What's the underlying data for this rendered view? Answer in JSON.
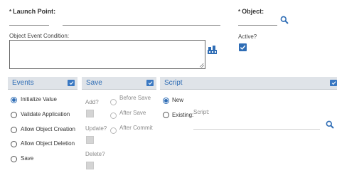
{
  "header": {
    "launch_point_label": "Launch Point:",
    "launch_point_value": "",
    "launch_point_description": "",
    "object_label": "Object:",
    "object_value": "",
    "event_condition_label": "Object Event Condition:",
    "event_condition_value": "",
    "active_label": "Active?",
    "active_checked": true
  },
  "events": {
    "title": "Events",
    "options": [
      {
        "label": "Initialize Value",
        "selected": true
      },
      {
        "label": "Validate Application",
        "selected": false
      },
      {
        "label": "Allow Object Creation",
        "selected": false
      },
      {
        "label": "Allow Object Deletion",
        "selected": false
      },
      {
        "label": "Save",
        "selected": false
      }
    ]
  },
  "save": {
    "title": "Save",
    "add_label": "Add?",
    "update_label": "Update?",
    "delete_label": "Delete?",
    "before_save_label": "Before Save",
    "after_save_label": "After Save",
    "after_commit_label": "After Commit"
  },
  "script": {
    "title": "Script",
    "new_label": "New",
    "existing_label": "Existing:",
    "script_field_label": "Script:",
    "script_value": ""
  },
  "colors": {
    "accent": "#2f6db5",
    "header_bg": "#dfe3e8"
  },
  "icons": [
    "search-icon",
    "lookup-icon",
    "checkbox-icon"
  ]
}
